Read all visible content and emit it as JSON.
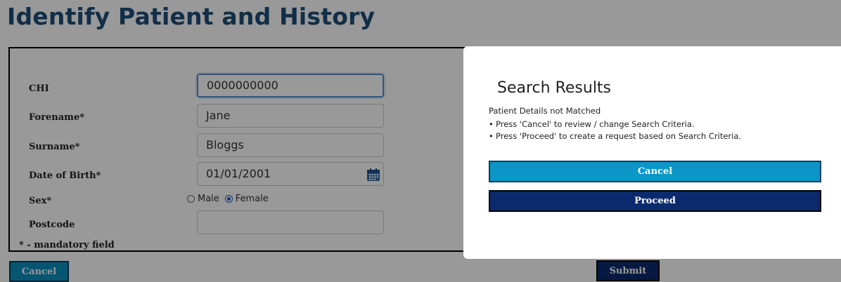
{
  "page": {
    "title": "Identify Patient and History"
  },
  "form": {
    "chi": {
      "label": "CHI",
      "value": "0000000000"
    },
    "forename": {
      "label": "Forename*",
      "value": "Jane"
    },
    "surname": {
      "label": "Surname*",
      "value": "Bloggs"
    },
    "dob": {
      "label": "Date of Birth*",
      "value": "01/01/2001",
      "icon": "calendar-icon"
    },
    "sex": {
      "label": "Sex*",
      "options": [
        {
          "label": "Male",
          "checked": false
        },
        {
          "label": "Female",
          "checked": true
        }
      ]
    },
    "postcode": {
      "label": "Postcode",
      "value": ""
    },
    "mandatory_note": "* - mandatory field"
  },
  "buttons": {
    "cancel": "Cancel",
    "submit": "Submit"
  },
  "modal": {
    "title": "Search Results",
    "message": "Patient Details not Matched",
    "bullets": [
      "Press 'Cancel' to review / change Search Criteria.",
      "Press 'Proceed' to create a request based on Search Criteria."
    ],
    "cancel_label": "Cancel",
    "proceed_label": "Proceed"
  },
  "colors": {
    "title": "#1f4e79",
    "cancel_button": "#0a96c6",
    "proceed_button": "#0b2a6e"
  }
}
